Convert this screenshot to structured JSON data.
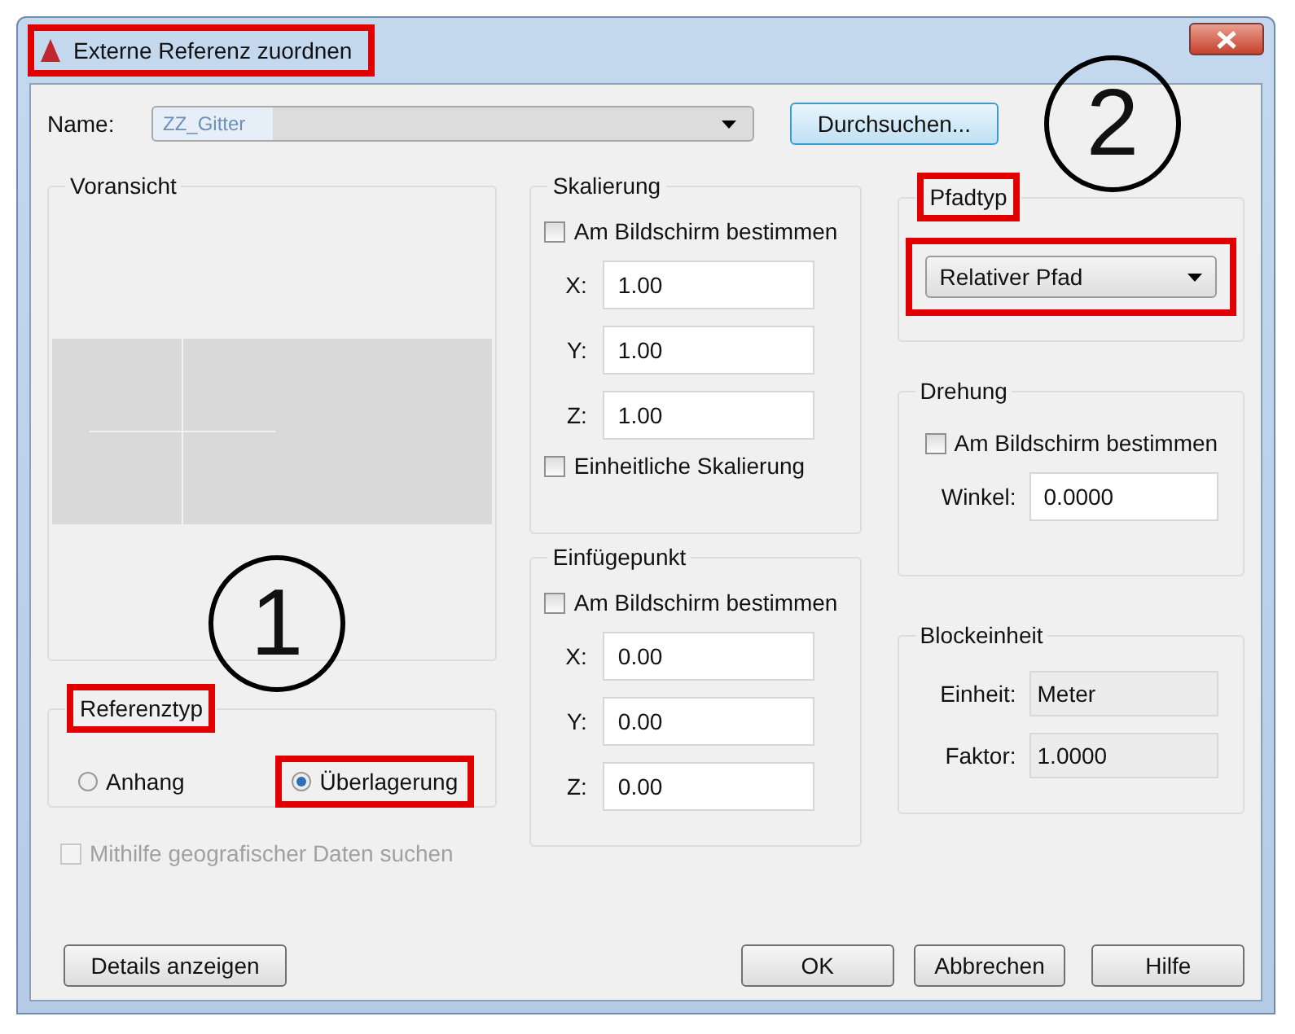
{
  "window": {
    "title": "Externe Referenz zuordnen",
    "title_highlighted": true
  },
  "name": {
    "label": "Name:",
    "value": "ZZ_Gitter"
  },
  "browse_button": {
    "label": "Durchsuchen..."
  },
  "preview": {
    "title": "Voransicht"
  },
  "reference_type": {
    "title": "Referenztyp",
    "title_highlighted": true,
    "options": [
      {
        "label": "Anhang",
        "selected": false,
        "highlighted": false
      },
      {
        "label": "Überlagerung",
        "selected": true,
        "highlighted": true
      }
    ]
  },
  "geo_checkbox": {
    "label": "Mithilfe geografischer Daten suchen",
    "checked": false,
    "disabled": true
  },
  "scaling": {
    "title": "Skalierung",
    "on_screen": {
      "label": "Am Bildschirm bestimmen",
      "checked": false
    },
    "fields": [
      {
        "label": "X:",
        "value": "1.00"
      },
      {
        "label": "Y:",
        "value": "1.00"
      },
      {
        "label": "Z:",
        "value": "1.00"
      }
    ],
    "uniform": {
      "label": "Einheitliche Skalierung",
      "checked": false
    }
  },
  "insertion_point": {
    "title": "Einfügepunkt",
    "on_screen": {
      "label": "Am Bildschirm bestimmen",
      "checked": false
    },
    "fields": [
      {
        "label": "X:",
        "value": "0.00"
      },
      {
        "label": "Y:",
        "value": "0.00"
      },
      {
        "label": "Z:",
        "value": "0.00"
      }
    ]
  },
  "path_type": {
    "title": "Pfadtyp",
    "title_highlighted": true,
    "value": "Relativer Pfad",
    "highlighted": true
  },
  "rotation": {
    "title": "Drehung",
    "on_screen": {
      "label": "Am Bildschirm bestimmen",
      "checked": false
    },
    "angle": {
      "label": "Winkel:",
      "value": "0.0000"
    }
  },
  "block_unit": {
    "title": "Blockeinheit",
    "unit": {
      "label": "Einheit:",
      "value": "Meter"
    },
    "factor": {
      "label": "Faktor:",
      "value": "1.0000"
    }
  },
  "buttons": [
    {
      "label": "Details anzeigen"
    },
    {
      "label": "OK"
    },
    {
      "label": "Abbrechen"
    },
    {
      "label": "Hilfe"
    }
  ],
  "annotations": [
    {
      "label": "1"
    },
    {
      "label": "2"
    }
  ]
}
